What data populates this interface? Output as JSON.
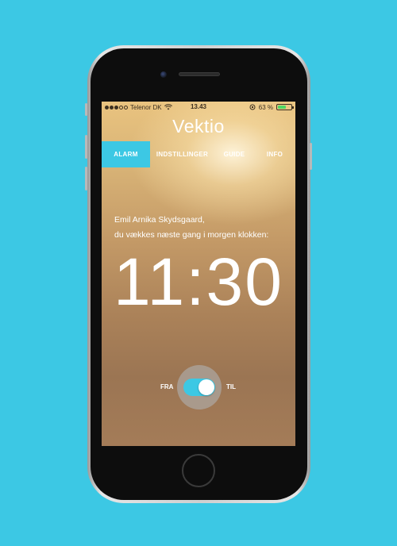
{
  "status_bar": {
    "carrier": "Telenor DK",
    "time": "13.43",
    "battery_percent": "63 %",
    "battery_level": 0.63
  },
  "app": {
    "title": "Vektio"
  },
  "tabs": [
    {
      "label": "ALARM",
      "active": true
    },
    {
      "label": "INDSTILLINGER",
      "active": false
    },
    {
      "label": "GUIDE",
      "active": false
    },
    {
      "label": "INFO",
      "active": false
    }
  ],
  "alarm": {
    "name_line": "Emil Arnika Skydsgaard,",
    "message_line": "du vækkes næste gang i morgen klokken:",
    "time": "11:30",
    "toggle_off_label": "FRA",
    "toggle_on_label": "TIL",
    "toggle_on": true
  },
  "colors": {
    "background": "#3cc8e4",
    "accent": "#3cc8e4"
  }
}
